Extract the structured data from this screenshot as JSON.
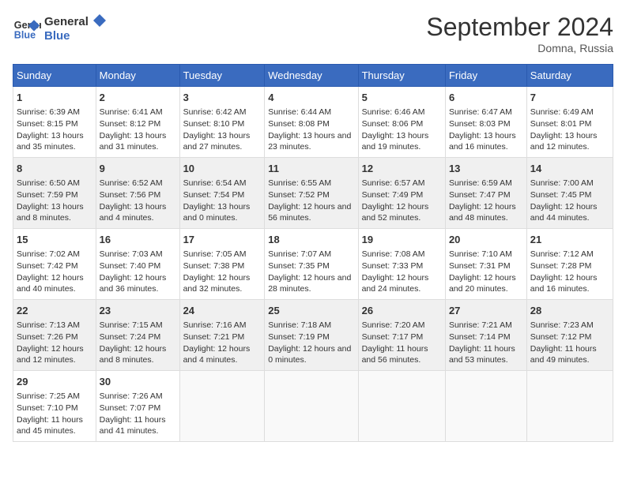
{
  "header": {
    "logo_line1": "General",
    "logo_line2": "Blue",
    "month_title": "September 2024",
    "location": "Domna, Russia"
  },
  "days_of_week": [
    "Sunday",
    "Monday",
    "Tuesday",
    "Wednesday",
    "Thursday",
    "Friday",
    "Saturday"
  ],
  "weeks": [
    [
      {
        "day": "1",
        "sunrise": "Sunrise: 6:39 AM",
        "sunset": "Sunset: 8:15 PM",
        "daylight": "Daylight: 13 hours and 35 minutes."
      },
      {
        "day": "2",
        "sunrise": "Sunrise: 6:41 AM",
        "sunset": "Sunset: 8:12 PM",
        "daylight": "Daylight: 13 hours and 31 minutes."
      },
      {
        "day": "3",
        "sunrise": "Sunrise: 6:42 AM",
        "sunset": "Sunset: 8:10 PM",
        "daylight": "Daylight: 13 hours and 27 minutes."
      },
      {
        "day": "4",
        "sunrise": "Sunrise: 6:44 AM",
        "sunset": "Sunset: 8:08 PM",
        "daylight": "Daylight: 13 hours and 23 minutes."
      },
      {
        "day": "5",
        "sunrise": "Sunrise: 6:46 AM",
        "sunset": "Sunset: 8:06 PM",
        "daylight": "Daylight: 13 hours and 19 minutes."
      },
      {
        "day": "6",
        "sunrise": "Sunrise: 6:47 AM",
        "sunset": "Sunset: 8:03 PM",
        "daylight": "Daylight: 13 hours and 16 minutes."
      },
      {
        "day": "7",
        "sunrise": "Sunrise: 6:49 AM",
        "sunset": "Sunset: 8:01 PM",
        "daylight": "Daylight: 13 hours and 12 minutes."
      }
    ],
    [
      {
        "day": "8",
        "sunrise": "Sunrise: 6:50 AM",
        "sunset": "Sunset: 7:59 PM",
        "daylight": "Daylight: 13 hours and 8 minutes."
      },
      {
        "day": "9",
        "sunrise": "Sunrise: 6:52 AM",
        "sunset": "Sunset: 7:56 PM",
        "daylight": "Daylight: 13 hours and 4 minutes."
      },
      {
        "day": "10",
        "sunrise": "Sunrise: 6:54 AM",
        "sunset": "Sunset: 7:54 PM",
        "daylight": "Daylight: 13 hours and 0 minutes."
      },
      {
        "day": "11",
        "sunrise": "Sunrise: 6:55 AM",
        "sunset": "Sunset: 7:52 PM",
        "daylight": "Daylight: 12 hours and 56 minutes."
      },
      {
        "day": "12",
        "sunrise": "Sunrise: 6:57 AM",
        "sunset": "Sunset: 7:49 PM",
        "daylight": "Daylight: 12 hours and 52 minutes."
      },
      {
        "day": "13",
        "sunrise": "Sunrise: 6:59 AM",
        "sunset": "Sunset: 7:47 PM",
        "daylight": "Daylight: 12 hours and 48 minutes."
      },
      {
        "day": "14",
        "sunrise": "Sunrise: 7:00 AM",
        "sunset": "Sunset: 7:45 PM",
        "daylight": "Daylight: 12 hours and 44 minutes."
      }
    ],
    [
      {
        "day": "15",
        "sunrise": "Sunrise: 7:02 AM",
        "sunset": "Sunset: 7:42 PM",
        "daylight": "Daylight: 12 hours and 40 minutes."
      },
      {
        "day": "16",
        "sunrise": "Sunrise: 7:03 AM",
        "sunset": "Sunset: 7:40 PM",
        "daylight": "Daylight: 12 hours and 36 minutes."
      },
      {
        "day": "17",
        "sunrise": "Sunrise: 7:05 AM",
        "sunset": "Sunset: 7:38 PM",
        "daylight": "Daylight: 12 hours and 32 minutes."
      },
      {
        "day": "18",
        "sunrise": "Sunrise: 7:07 AM",
        "sunset": "Sunset: 7:35 PM",
        "daylight": "Daylight: 12 hours and 28 minutes."
      },
      {
        "day": "19",
        "sunrise": "Sunrise: 7:08 AM",
        "sunset": "Sunset: 7:33 PM",
        "daylight": "Daylight: 12 hours and 24 minutes."
      },
      {
        "day": "20",
        "sunrise": "Sunrise: 7:10 AM",
        "sunset": "Sunset: 7:31 PM",
        "daylight": "Daylight: 12 hours and 20 minutes."
      },
      {
        "day": "21",
        "sunrise": "Sunrise: 7:12 AM",
        "sunset": "Sunset: 7:28 PM",
        "daylight": "Daylight: 12 hours and 16 minutes."
      }
    ],
    [
      {
        "day": "22",
        "sunrise": "Sunrise: 7:13 AM",
        "sunset": "Sunset: 7:26 PM",
        "daylight": "Daylight: 12 hours and 12 minutes."
      },
      {
        "day": "23",
        "sunrise": "Sunrise: 7:15 AM",
        "sunset": "Sunset: 7:24 PM",
        "daylight": "Daylight: 12 hours and 8 minutes."
      },
      {
        "day": "24",
        "sunrise": "Sunrise: 7:16 AM",
        "sunset": "Sunset: 7:21 PM",
        "daylight": "Daylight: 12 hours and 4 minutes."
      },
      {
        "day": "25",
        "sunrise": "Sunrise: 7:18 AM",
        "sunset": "Sunset: 7:19 PM",
        "daylight": "Daylight: 12 hours and 0 minutes."
      },
      {
        "day": "26",
        "sunrise": "Sunrise: 7:20 AM",
        "sunset": "Sunset: 7:17 PM",
        "daylight": "Daylight: 11 hours and 56 minutes."
      },
      {
        "day": "27",
        "sunrise": "Sunrise: 7:21 AM",
        "sunset": "Sunset: 7:14 PM",
        "daylight": "Daylight: 11 hours and 53 minutes."
      },
      {
        "day": "28",
        "sunrise": "Sunrise: 7:23 AM",
        "sunset": "Sunset: 7:12 PM",
        "daylight": "Daylight: 11 hours and 49 minutes."
      }
    ],
    [
      {
        "day": "29",
        "sunrise": "Sunrise: 7:25 AM",
        "sunset": "Sunset: 7:10 PM",
        "daylight": "Daylight: 11 hours and 45 minutes."
      },
      {
        "day": "30",
        "sunrise": "Sunrise: 7:26 AM",
        "sunset": "Sunset: 7:07 PM",
        "daylight": "Daylight: 11 hours and 41 minutes."
      },
      null,
      null,
      null,
      null,
      null
    ]
  ]
}
